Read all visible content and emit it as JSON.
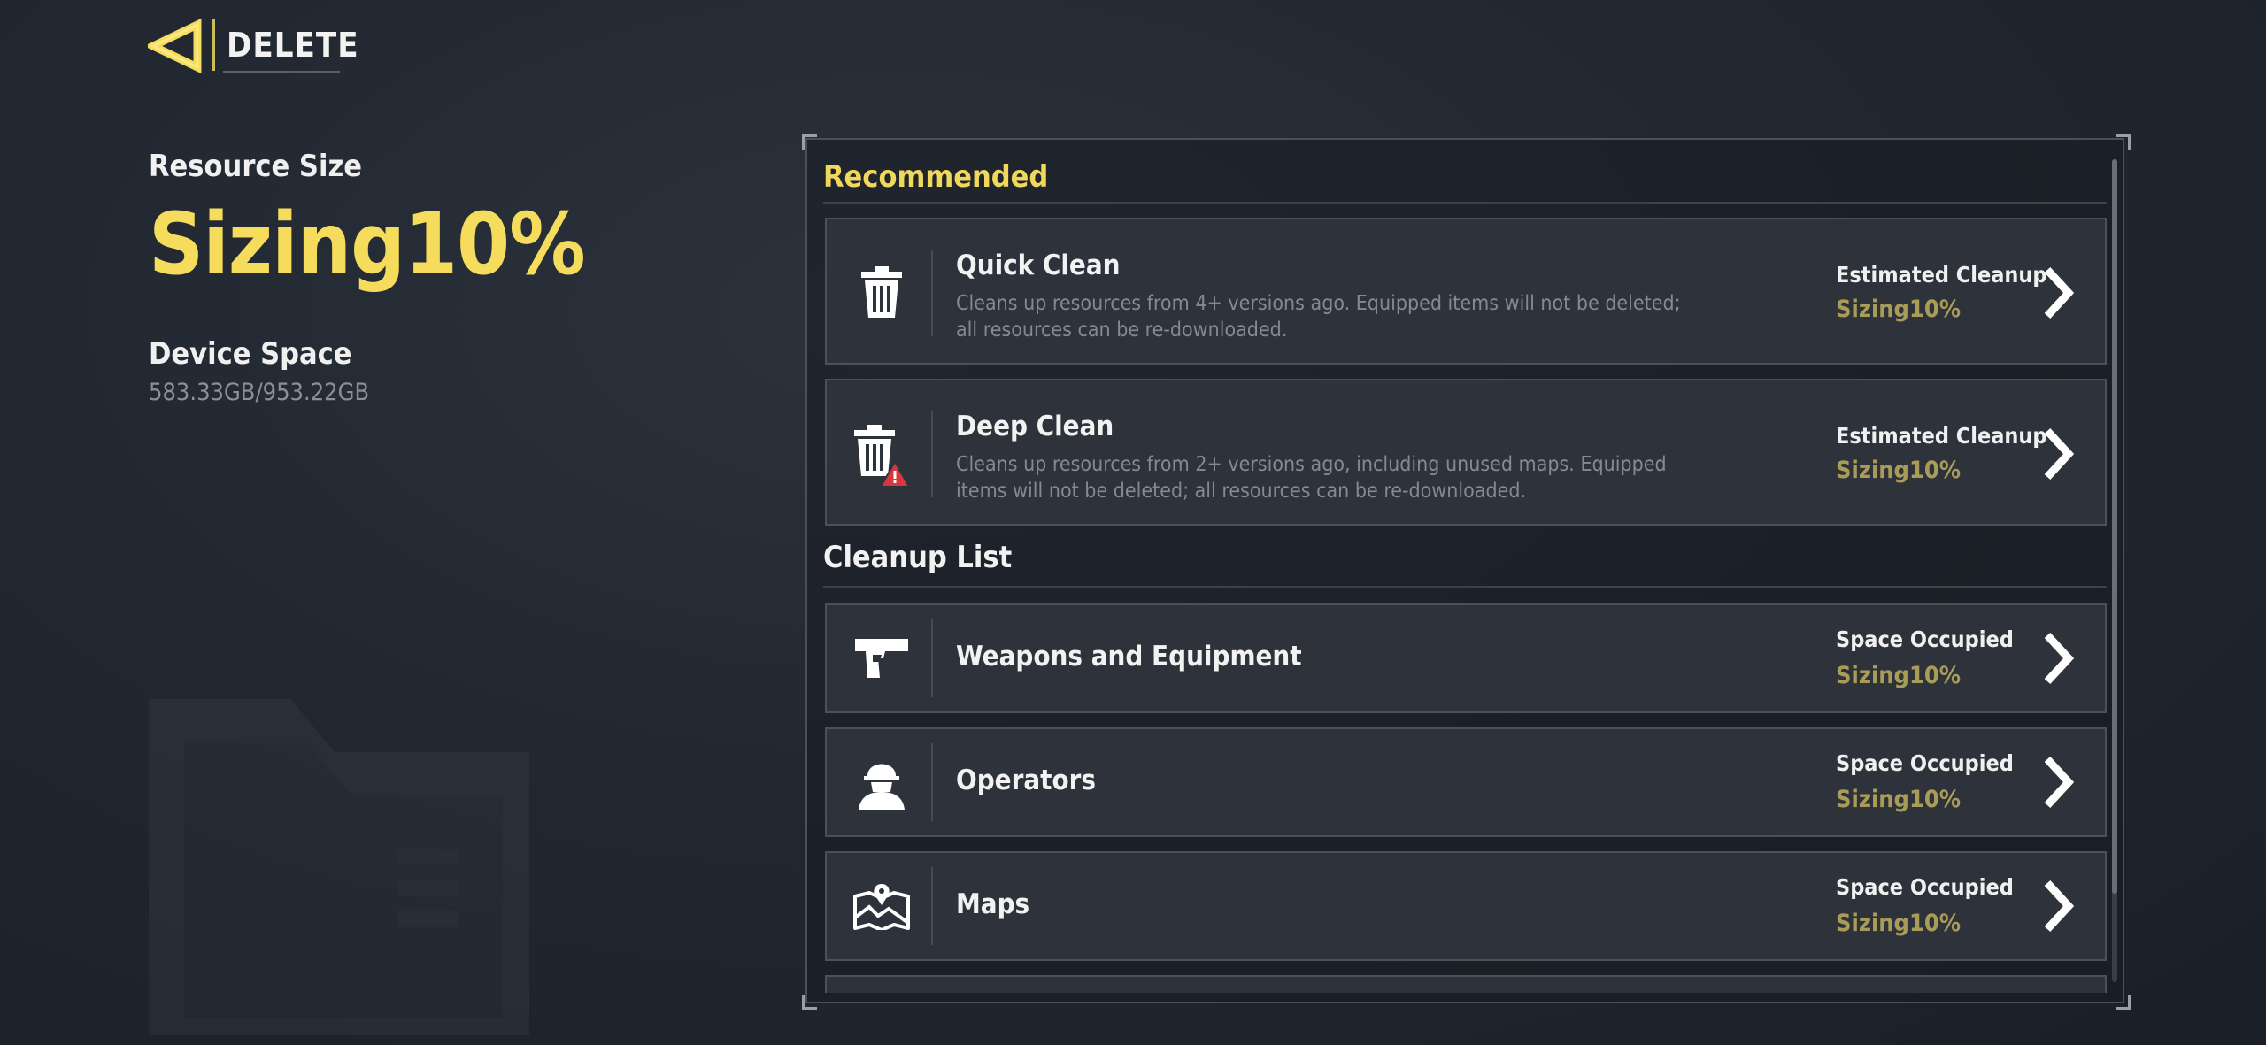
{
  "header": {
    "title": "DELETE",
    "back_icon": "back-arrow-icon",
    "accent_color": "#f5dc5c"
  },
  "summary": {
    "resource_label": "Resource Size",
    "resource_value": "Sizing10%",
    "device_label": "Device Space",
    "device_value": "583.33GB/953.22GB"
  },
  "recommended": {
    "title": "Recommended",
    "items": [
      {
        "title": "Quick Clean",
        "description": "Cleans up resources from 4+ versions ago. Equipped items will not be deleted; all resources can be re-downloaded.",
        "meta_label": "Estimated Cleanup",
        "meta_value": "Sizing10%",
        "icon": "trash-icon"
      },
      {
        "title": "Deep Clean",
        "description": "Cleans up resources from 2+ versions ago, including unused maps. Equipped items will not be deleted; all resources can be re-downloaded.",
        "meta_label": "Estimated Cleanup",
        "meta_value": "Sizing10%",
        "icon": "trash-warning-icon"
      }
    ]
  },
  "cleanup_list": {
    "title": "Cleanup List",
    "items": [
      {
        "title": "Weapons and Equipment",
        "meta_label": "Space Occupied",
        "meta_value": "Sizing10%",
        "icon": "pistol-icon"
      },
      {
        "title": "Operators",
        "meta_label": "Space Occupied",
        "meta_value": "Sizing10%",
        "icon": "operator-icon"
      },
      {
        "title": "Maps",
        "meta_label": "Space Occupied",
        "meta_value": "Sizing10%",
        "icon": "map-icon"
      }
    ]
  },
  "colors": {
    "accent_yellow": "#f0d85a",
    "muted_gold": "#a89c58",
    "card_bg": "#2e333b",
    "warning_red": "#d9363e"
  }
}
